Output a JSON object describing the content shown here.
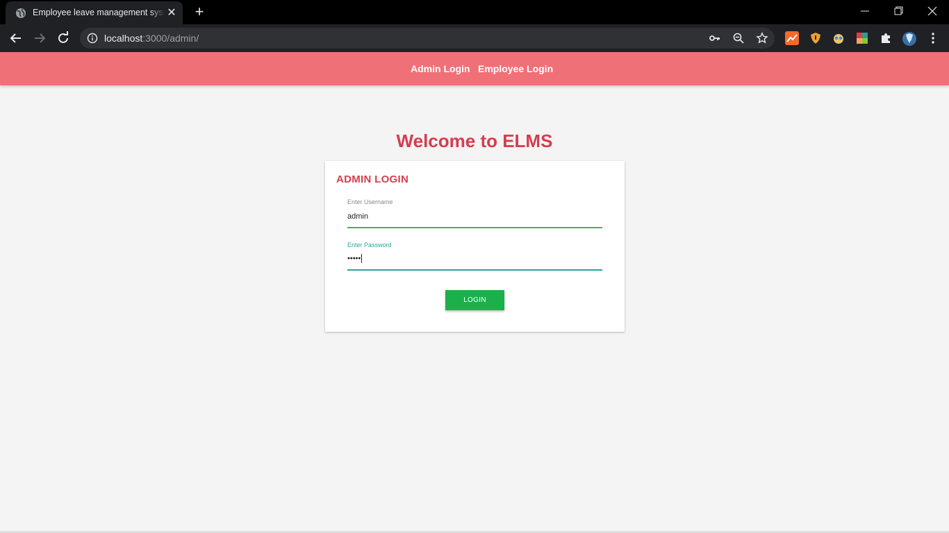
{
  "browser": {
    "tab_title": "Employee leave management system",
    "close_glyph": "✕",
    "new_tab_glyph": "+",
    "url_host": "localhost",
    "url_rest": ":3000/admin/"
  },
  "nav": {
    "admin_login": "Admin Login",
    "employee_login": "Employee Login"
  },
  "page": {
    "welcome": "Welcome to ELMS"
  },
  "login_card": {
    "title": "ADMIN LOGIN",
    "username_label": "Enter Username",
    "username_value": "admin",
    "password_label": "Enter Password",
    "password_value": "•••••",
    "button_label": "LOGIN"
  },
  "colors": {
    "navbar": "#f07077",
    "accent_red": "#d63d4e",
    "button_green": "#1bb049",
    "username_line": "#4caf50",
    "password_focus": "#26a69a"
  }
}
